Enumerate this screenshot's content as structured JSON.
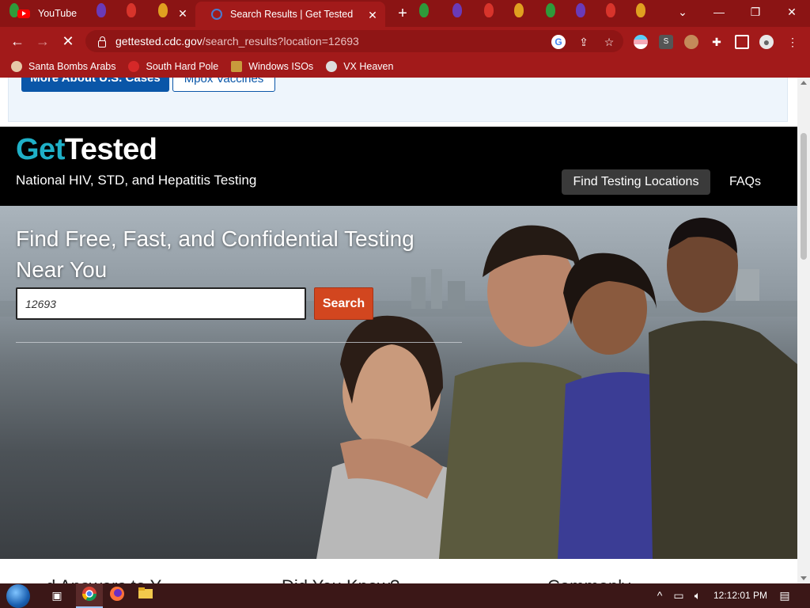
{
  "browser": {
    "tabs": [
      {
        "title": "YouTube",
        "active": false
      },
      {
        "title": "Search Results | Get Tested",
        "active": true
      }
    ],
    "url_host": "gettested.cdc.gov",
    "url_path": "/search_results?location=12693",
    "bookmarks": [
      {
        "label": "Santa Bombs Arabs"
      },
      {
        "label": "South Hard Pole"
      },
      {
        "label": "Windows ISOs"
      },
      {
        "label": "VX Heaven"
      }
    ],
    "accent_color": "#a21a1a"
  },
  "page": {
    "alert_buttons": {
      "primary": "More About U.S. Cases",
      "secondary": "Mpox Vaccines"
    },
    "logo": {
      "part1": "Get",
      "part2": "Tested"
    },
    "tagline": "National HIV, STD, and Hepatitis Testing",
    "nav": {
      "find_locations": "Find Testing Locations",
      "faqs": "FAQs"
    },
    "hero": {
      "title": "Find Free, Fast, and Confidential Testing Near You",
      "search_value": "12693",
      "search_button": "Search"
    },
    "below_fold": {
      "col1": "d Answers to Y",
      "col2": "Did You Know?",
      "col3": "Commonly"
    }
  },
  "taskbar": {
    "clock": "12:12:01 PM"
  }
}
